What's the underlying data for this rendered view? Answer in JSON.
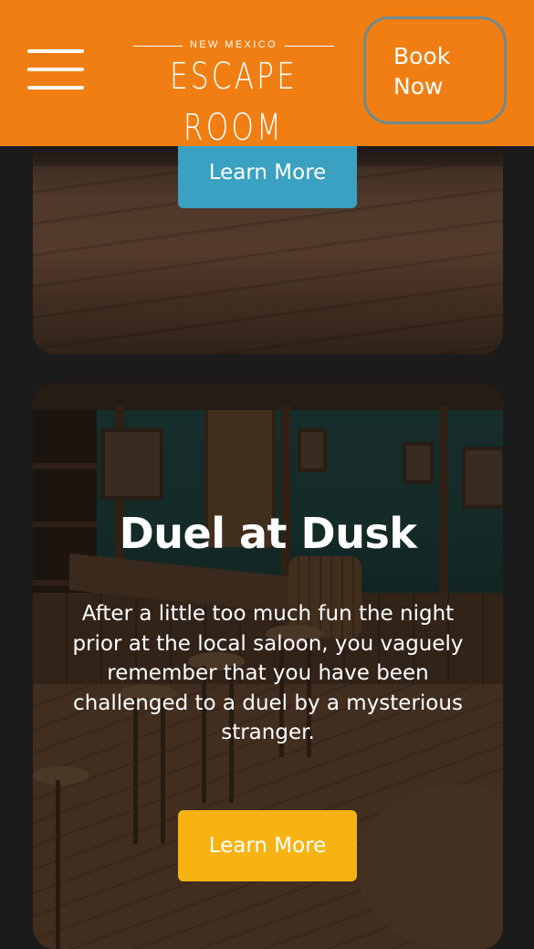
{
  "header": {
    "logo_subtitle": "NEW MEXICO",
    "logo_title": "ESCAPE ROOM",
    "book_button_label": "Book Now",
    "menu_icon": "hamburger-menu-icon",
    "brand_color": "#f07e12"
  },
  "cards": [
    {
      "learn_more_label": "Learn More",
      "button_color": "#3aa1c2"
    },
    {
      "title": "Duel at Dusk",
      "description": "After a little too much fun the night prior at the local saloon, you vaguely remember that you have been challenged to a duel by a mysterious stranger.",
      "learn_more_label": "Learn More",
      "button_color": "#f6b312"
    }
  ]
}
